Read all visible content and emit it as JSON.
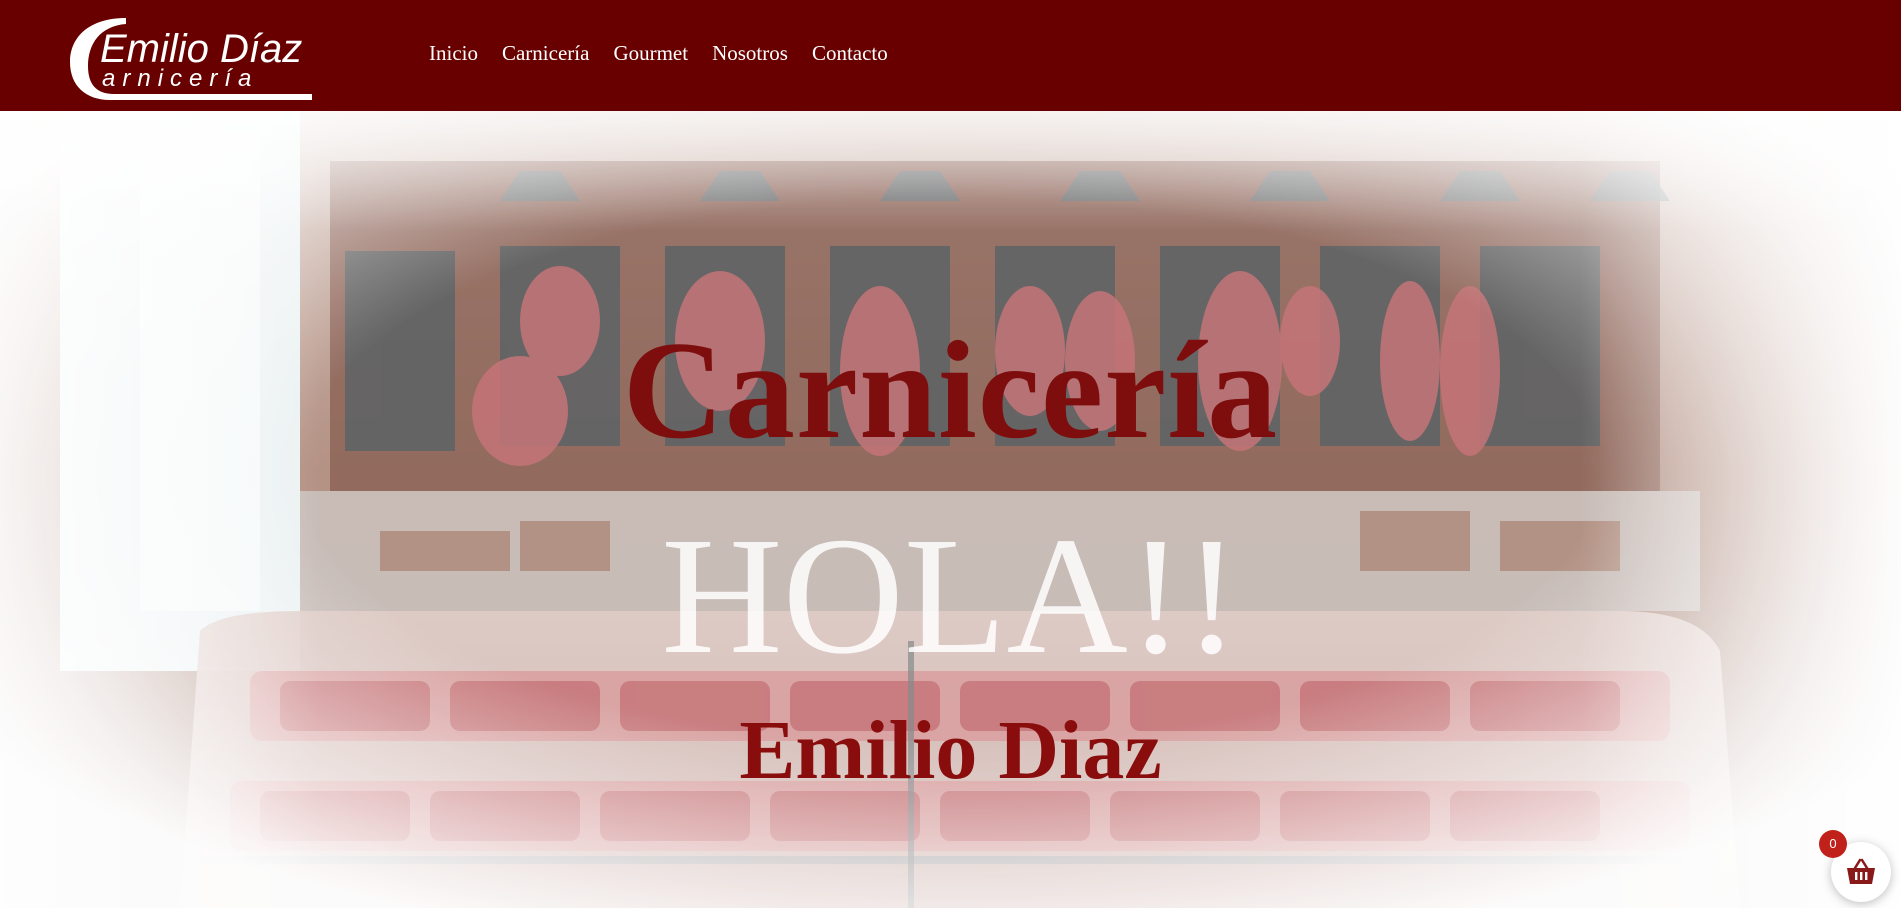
{
  "header": {
    "background_color": "#680000",
    "logo": {
      "line1": "Emilio Díaz",
      "line2": "arnicería"
    },
    "nav": [
      {
        "label": "Inicio"
      },
      {
        "label": "Carnicería"
      },
      {
        "label": "Gourmet"
      },
      {
        "label": "Nosotros"
      },
      {
        "label": "Contacto"
      }
    ]
  },
  "hero": {
    "title": "Carnicería",
    "greeting": "HOLA!!",
    "subtitle": "Emilio Diaz",
    "title_color": "#7e0e0e"
  },
  "cart": {
    "icon": "basket-icon",
    "count": "0",
    "badge_color": "#c0221b"
  }
}
